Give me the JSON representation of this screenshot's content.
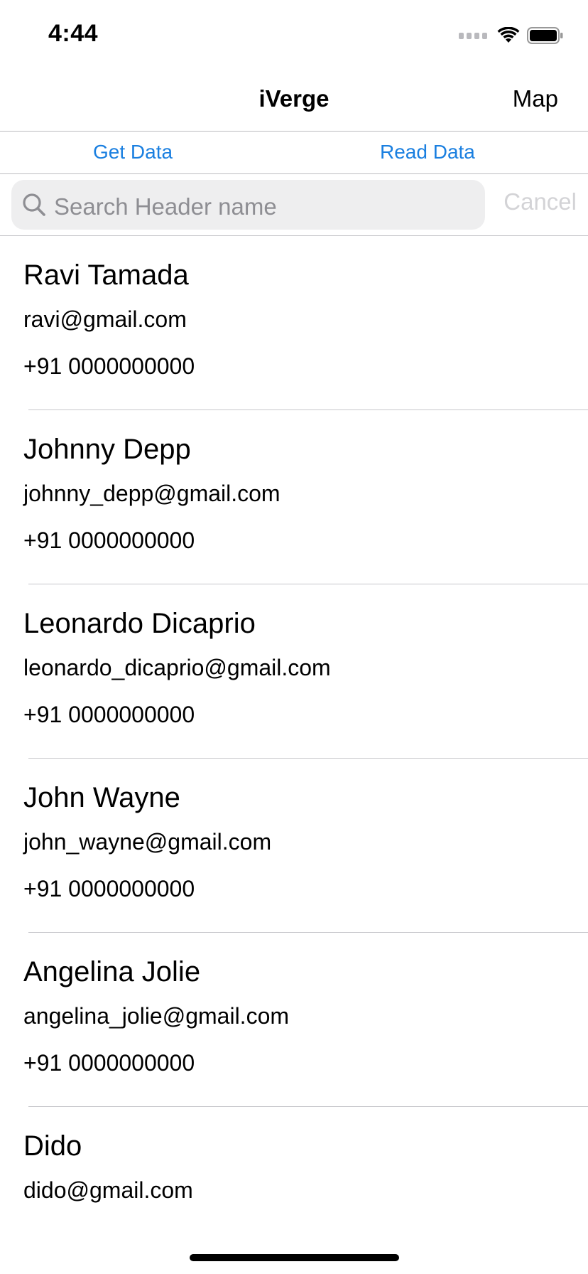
{
  "status_bar": {
    "time": "4:44"
  },
  "nav": {
    "title": "iVerge",
    "right_button": "Map"
  },
  "actions": {
    "get_data": "Get Data",
    "read_data": "Read Data"
  },
  "search": {
    "placeholder": "Search Header name",
    "cancel": "Cancel"
  },
  "contacts": [
    {
      "name": "Ravi Tamada",
      "email": "ravi@gmail.com",
      "phone": "+91 0000000000"
    },
    {
      "name": "Johnny Depp",
      "email": "johnny_depp@gmail.com",
      "phone": "+91 0000000000"
    },
    {
      "name": "Leonardo Dicaprio",
      "email": "leonardo_dicaprio@gmail.com",
      "phone": "+91 0000000000"
    },
    {
      "name": "John Wayne",
      "email": "john_wayne@gmail.com",
      "phone": "+91 0000000000"
    },
    {
      "name": "Angelina Jolie",
      "email": "angelina_jolie@gmail.com",
      "phone": "+91 0000000000"
    },
    {
      "name": "Dido",
      "email": "dido@gmail.com",
      "phone": ""
    }
  ],
  "colors": {
    "accent": "#1a7fe0",
    "separator": "#c6c6ca",
    "search_bg": "#eeeeef",
    "placeholder": "#8e8e93"
  },
  "icons": [
    "signal-icon",
    "wifi-icon",
    "battery-icon",
    "search-icon"
  ]
}
